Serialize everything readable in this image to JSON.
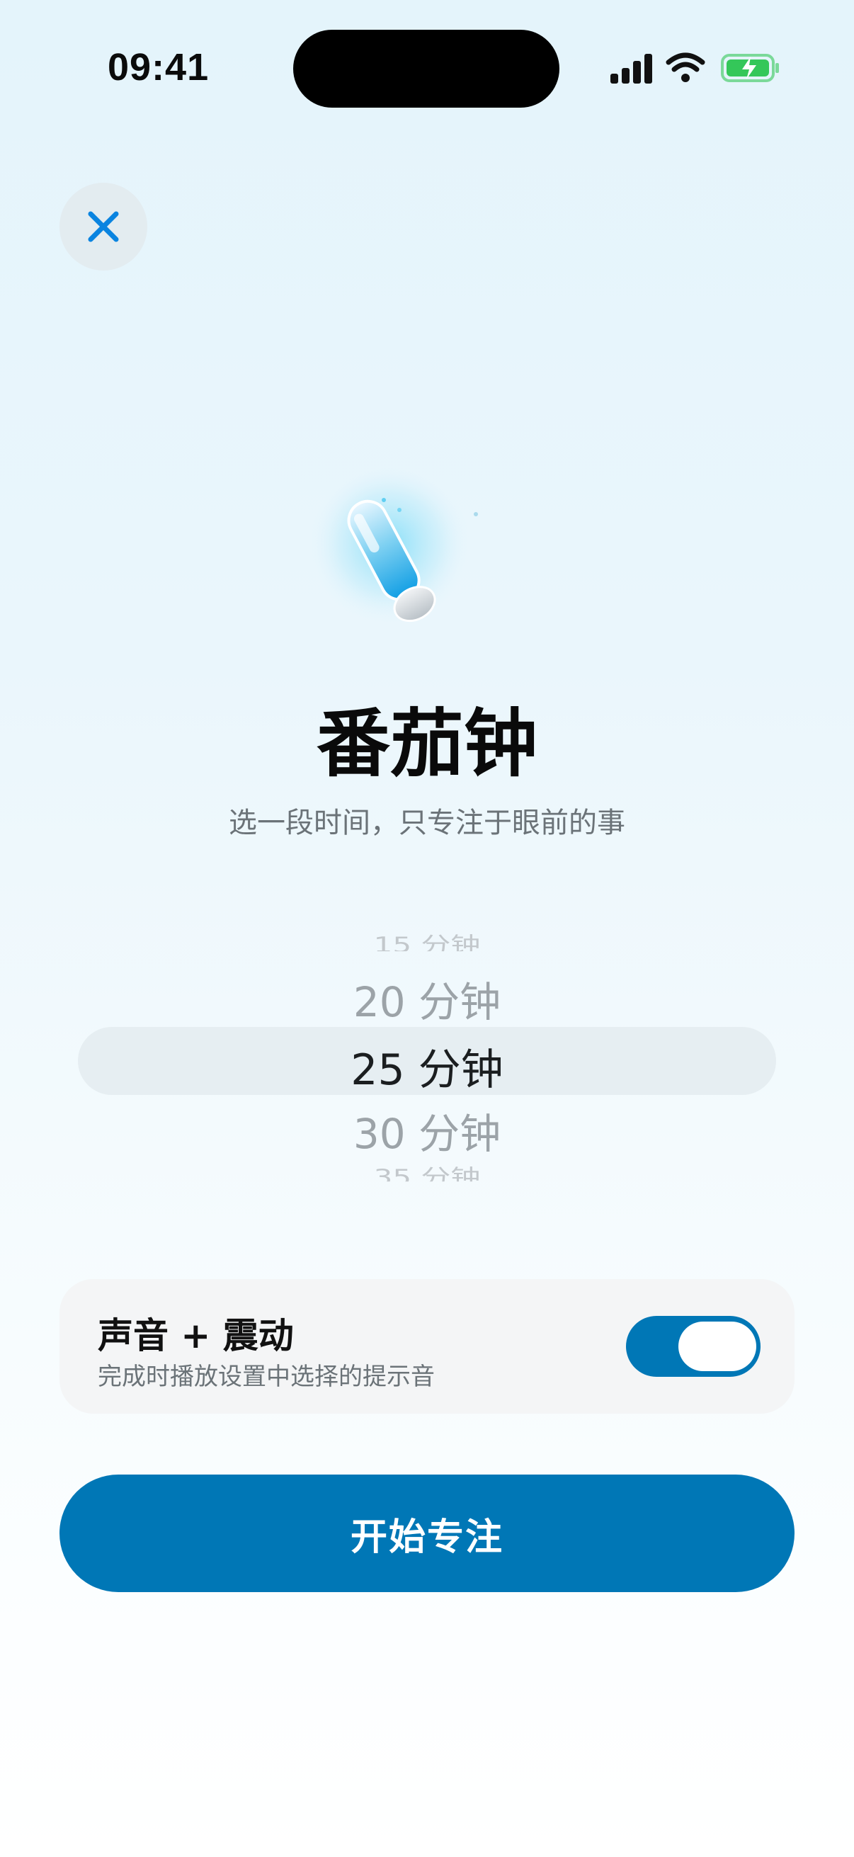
{
  "status_bar": {
    "time": "09:41",
    "icons": [
      "cellular-signal-icon",
      "wifi-icon",
      "battery-charging-icon"
    ]
  },
  "header": {
    "close_icon": "close-icon"
  },
  "hero": {
    "icon": "timer-capsule-icon",
    "title": "番茄钟",
    "subtitle": "选一段时间，只专注于眼前的事"
  },
  "duration_picker": {
    "options": [
      "15 分钟",
      "20 分钟",
      "25 分钟",
      "30 分钟",
      "35 分钟"
    ],
    "selected": "25 分钟"
  },
  "sound_setting": {
    "title": "声音 + 震动",
    "description": "完成时播放设置中选择的提示音",
    "enabled": true
  },
  "primary_action": {
    "label": "开始专注"
  },
  "colors": {
    "accent": "#0077b6",
    "close_icon": "#0a84e0",
    "battery": "#34c759"
  }
}
